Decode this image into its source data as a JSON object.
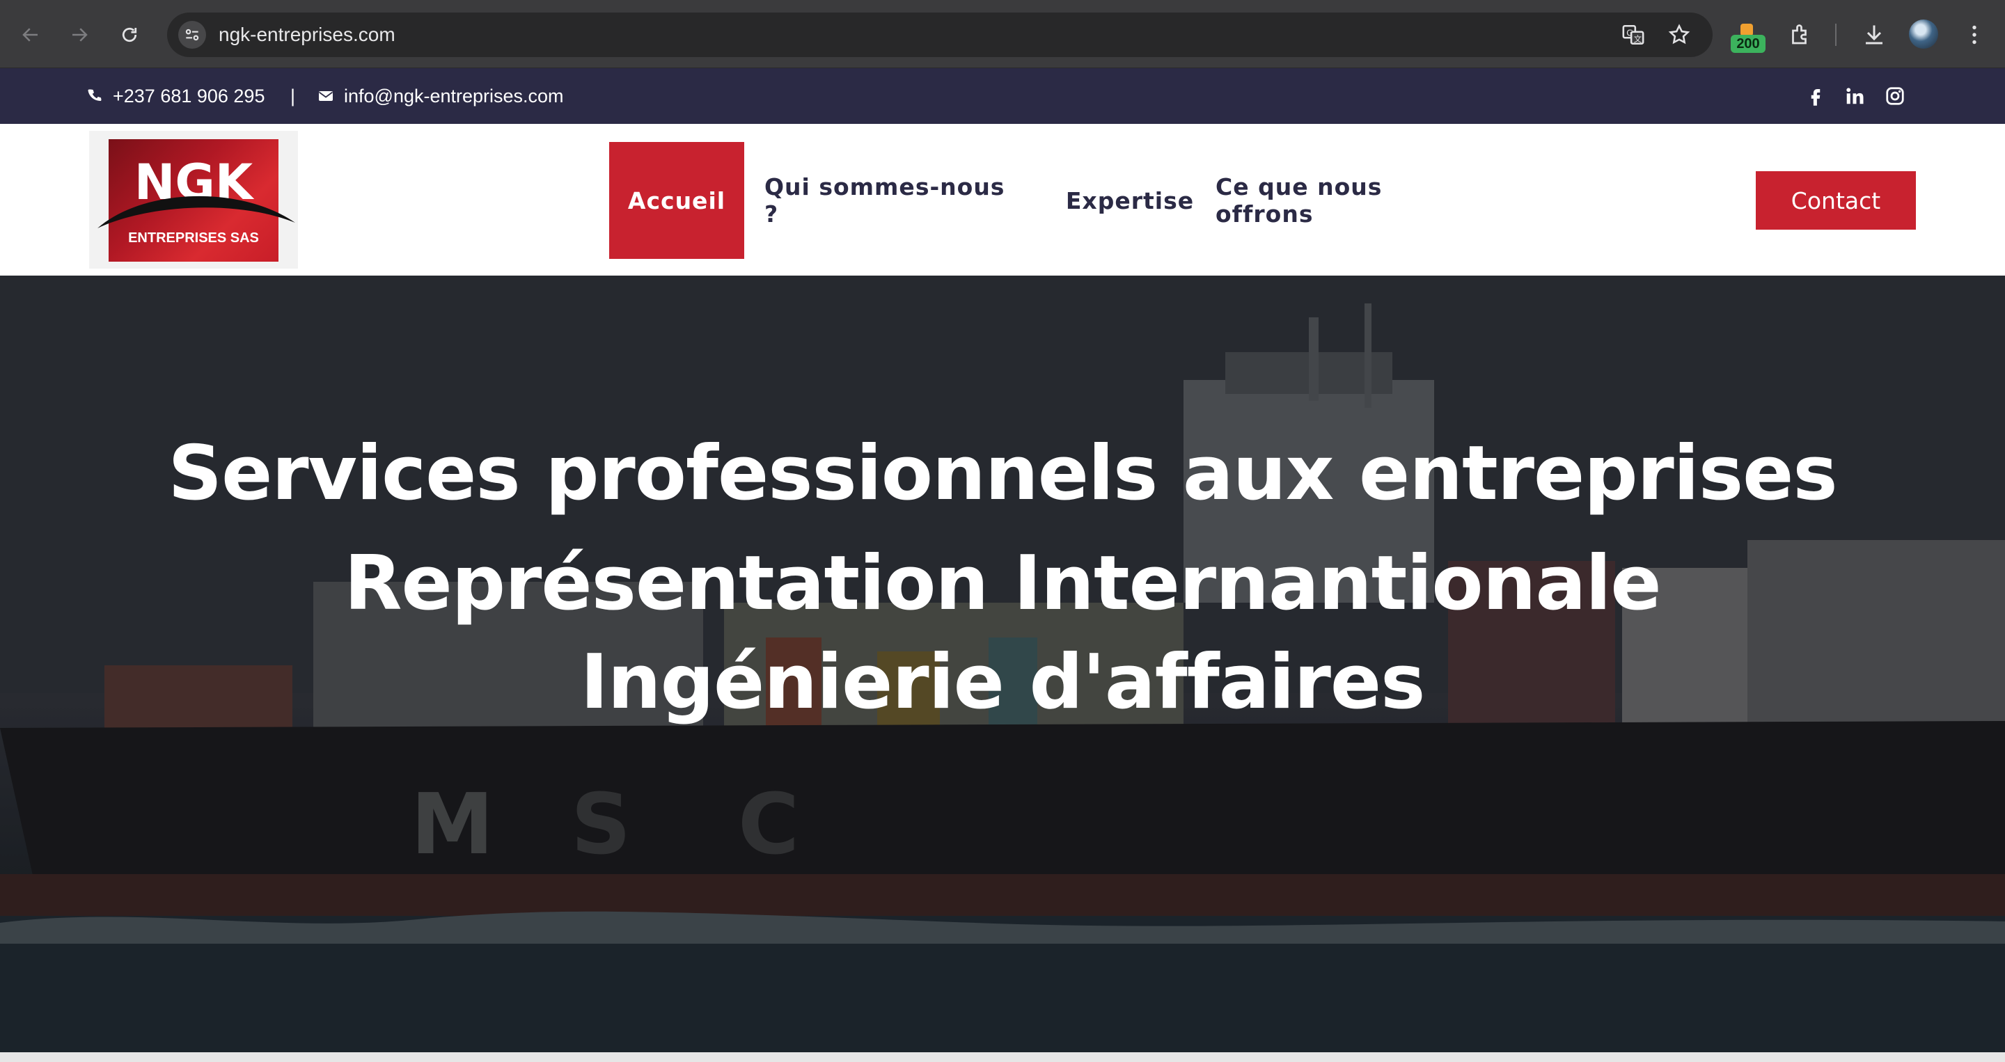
{
  "browser": {
    "url": "ngk-entreprises.com",
    "extension_badge": "200",
    "icons": [
      "back-icon",
      "forward-icon",
      "reload-icon",
      "site-settings-icon",
      "translate-icon",
      "star-icon",
      "extension-icon",
      "puzzle-icon",
      "download-icon",
      "profile-avatar",
      "more-icon"
    ]
  },
  "topbar": {
    "phone": "+237 681 906 295",
    "separator": "|",
    "email": "info@ngk-entreprises.com",
    "social": [
      "facebook-icon",
      "linkedin-icon",
      "instagram-icon"
    ]
  },
  "header": {
    "logo": {
      "brand": "NGK",
      "subtitle": "ENTREPRISES SAS"
    },
    "menu": [
      {
        "label": "Accueil",
        "active": true
      },
      {
        "label": "Qui sommes-nous ?",
        "active": false
      },
      {
        "label": "Expertise",
        "active": false
      },
      {
        "label": "Ce que nous offrons",
        "active": false
      }
    ],
    "contact_label": "Contact"
  },
  "hero": {
    "line1": "Services professionnels aux entreprises",
    "line2": "Représentation Internantionale",
    "line3": "Ingénierie d'affaires"
  },
  "colors": {
    "accent": "#c8222f",
    "topbar": "#2b2a45",
    "nav_text": "#2b2a45"
  }
}
